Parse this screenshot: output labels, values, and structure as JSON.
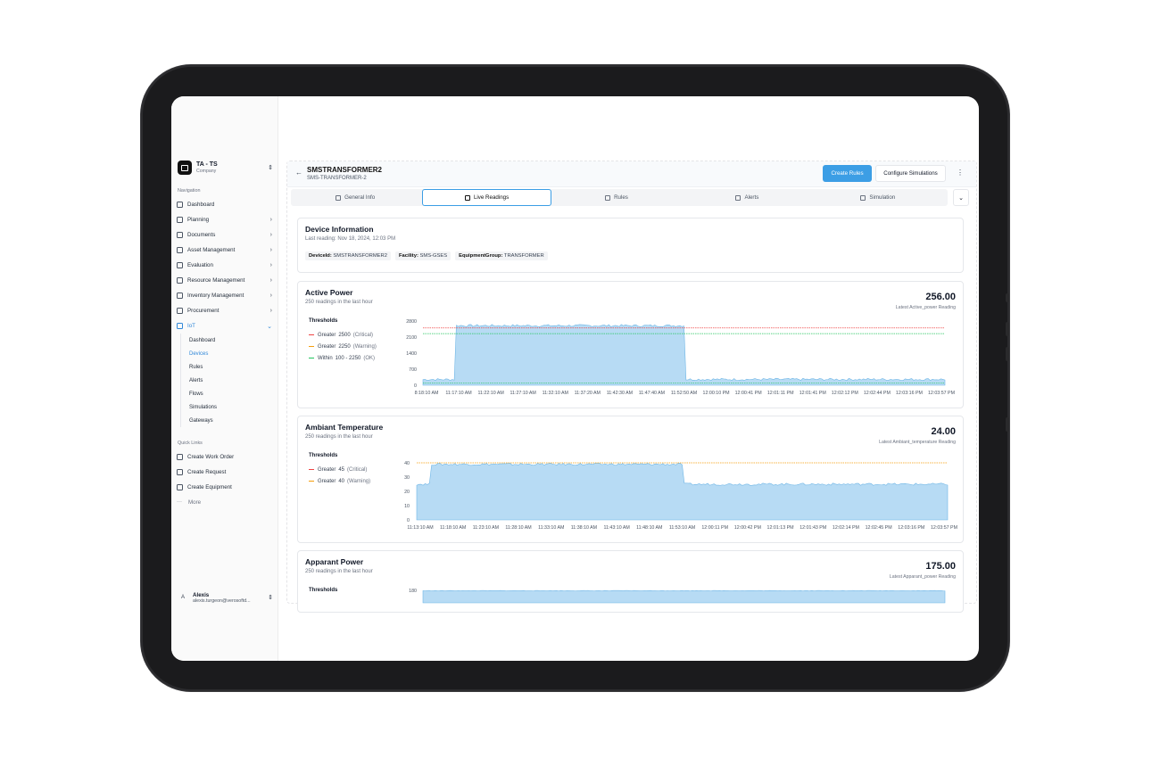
{
  "company": {
    "name": "TA - TS",
    "subtitle": "Company"
  },
  "sidebar": {
    "navigation_label": "Navigation",
    "items": [
      {
        "label": "Dashboard",
        "icon": "dashboard-icon",
        "chevron": false
      },
      {
        "label": "Planning",
        "icon": "chart-icon",
        "chevron": true
      },
      {
        "label": "Documents",
        "icon": "documents-icon",
        "chevron": true
      },
      {
        "label": "Asset Management",
        "icon": "asset-icon",
        "chevron": true
      },
      {
        "label": "Evaluation",
        "icon": "evaluation-icon",
        "chevron": true
      },
      {
        "label": "Resource Management",
        "icon": "resource-icon",
        "chevron": true
      },
      {
        "label": "Inventory Management",
        "icon": "inventory-icon",
        "chevron": true
      },
      {
        "label": "Procurement",
        "icon": "procurement-icon",
        "chevron": true
      },
      {
        "label": "IoT",
        "icon": "iot-icon",
        "chevron": true,
        "active": true
      }
    ],
    "iot_sub": [
      "Dashboard",
      "Devices",
      "Rules",
      "Alerts",
      "Flows",
      "Simulations",
      "Gateways"
    ],
    "quick_links_label": "Quick Links",
    "quick_links": [
      "Create Work Order",
      "Create Request",
      "Create Equipment",
      "More"
    ]
  },
  "user": {
    "initial": "A",
    "name": "Alexis",
    "email": "alexis.turgeon@verosoftd..."
  },
  "device": {
    "title": "SMSTRANSFORMER2",
    "subtitle": "SMS-TRANSFORMER-2"
  },
  "actions": {
    "create_rules": "Create Rules",
    "configure_simulations": "Configure Simulations"
  },
  "tabs": [
    "General Info",
    "Live Readings",
    "Rules",
    "Alerts",
    "Simulation"
  ],
  "device_info": {
    "title": "Device Information",
    "last_reading": "Last reading: Nov 18, 2024, 12:03 PM",
    "chips": [
      {
        "key": "DeviceId:",
        "value": "SMSTRANSFORMER2"
      },
      {
        "key": "Facility:",
        "value": "SMS-GSES"
      },
      {
        "key": "EquipmentGroup:",
        "value": "TRANSFORMER"
      }
    ]
  },
  "colors": {
    "fill": "#b7dbf4",
    "stroke": "#6fb6e6",
    "critical": "#ef4444",
    "warning": "#f59e0b",
    "ok": "#22c55e",
    "accent": "#3c9ee5"
  },
  "cards": [
    {
      "title": "Active Power",
      "subtitle": "250 readings in the last hour",
      "reading": "256.00",
      "reading_label": "Latest Active_power Reading",
      "thresholds_label": "Thresholds",
      "thresholds": [
        {
          "kind": "critical",
          "op": "Greater",
          "value": "2500",
          "label": "(Critical)"
        },
        {
          "kind": "warning",
          "op": "Greater",
          "value": "2250",
          "label": "(Warning)"
        },
        {
          "kind": "ok",
          "op": "Within",
          "value": "100 - 2250",
          "label": "(OK)"
        }
      ]
    },
    {
      "title": "Ambiant Temperature",
      "subtitle": "250 readings in the last hour",
      "reading": "24.00",
      "reading_label": "Latest Ambiant_temperature Reading",
      "thresholds_label": "Thresholds",
      "thresholds": [
        {
          "kind": "critical",
          "op": "Greater",
          "value": "45",
          "label": "(Critical)"
        },
        {
          "kind": "warning",
          "op": "Greater",
          "value": "40",
          "label": "(Warning)"
        }
      ]
    },
    {
      "title": "Apparant Power",
      "subtitle": "250 readings in the last hour",
      "reading": "175.00",
      "reading_label": "Latest Apparant_power Reading",
      "thresholds_label": "Thresholds",
      "thresholds": []
    }
  ],
  "chart_data": [
    {
      "type": "area",
      "title": "Active Power",
      "ylim": [
        0,
        2800
      ],
      "yticks": [
        0,
        700,
        1400,
        2100,
        2800
      ],
      "xticks": [
        "8:18:10 AM",
        "11:17:10 AM",
        "11:22:10 AM",
        "11:27:10 AM",
        "11:32:10 AM",
        "11:37:20 AM",
        "11:42:30 AM",
        "11:47:40 AM",
        "11:52:50 AM",
        "12:00:10 PM",
        "12:00:41 PM",
        "12:01:11 PM",
        "12:01:41 PM",
        "12:02:12 PM",
        "12:02:44 PM",
        "12:03:16 PM",
        "12:03:57 PM"
      ],
      "segments": [
        {
          "from": 0.0,
          "to": 0.06,
          "value": 250
        },
        {
          "from": 0.06,
          "to": 0.5,
          "value": 2600
        },
        {
          "from": 0.5,
          "to": 1.0,
          "value": 256
        }
      ],
      "threshold_lines": [
        {
          "kind": "critical",
          "value": 2500
        },
        {
          "kind": "ok",
          "value": 2250
        },
        {
          "kind": "ok",
          "value": 100
        }
      ],
      "grid": false
    },
    {
      "type": "area",
      "title": "Ambiant Temperature",
      "ylim": [
        0,
        45
      ],
      "yticks": [
        0,
        10,
        20,
        30,
        40
      ],
      "xticks": [
        "11:13:10 AM",
        "11:18:10 AM",
        "11:23:10 AM",
        "11:28:10 AM",
        "11:33:10 AM",
        "11:38:10 AM",
        "11:43:10 AM",
        "11:48:10 AM",
        "11:53:10 AM",
        "12:00:11 PM",
        "12:00:42 PM",
        "12:01:13 PM",
        "12:01:43 PM",
        "12:02:14 PM",
        "12:02:45 PM",
        "12:03:16 PM",
        "12:03:57 PM"
      ],
      "segments": [
        {
          "from": 0.0,
          "to": 0.025,
          "value": 25
        },
        {
          "from": 0.025,
          "to": 0.5,
          "value": 39
        },
        {
          "from": 0.5,
          "to": 1.0,
          "value": 25
        }
      ],
      "threshold_lines": [
        {
          "kind": "warning",
          "value": 40
        }
      ],
      "grid": false
    },
    {
      "type": "area",
      "title": "Apparant Power",
      "ylim": [
        0,
        180
      ],
      "yticks": [
        180
      ],
      "xticks": [],
      "segments": [
        {
          "from": 0.0,
          "to": 1.0,
          "value": 175
        }
      ],
      "threshold_lines": [],
      "grid": false
    }
  ]
}
